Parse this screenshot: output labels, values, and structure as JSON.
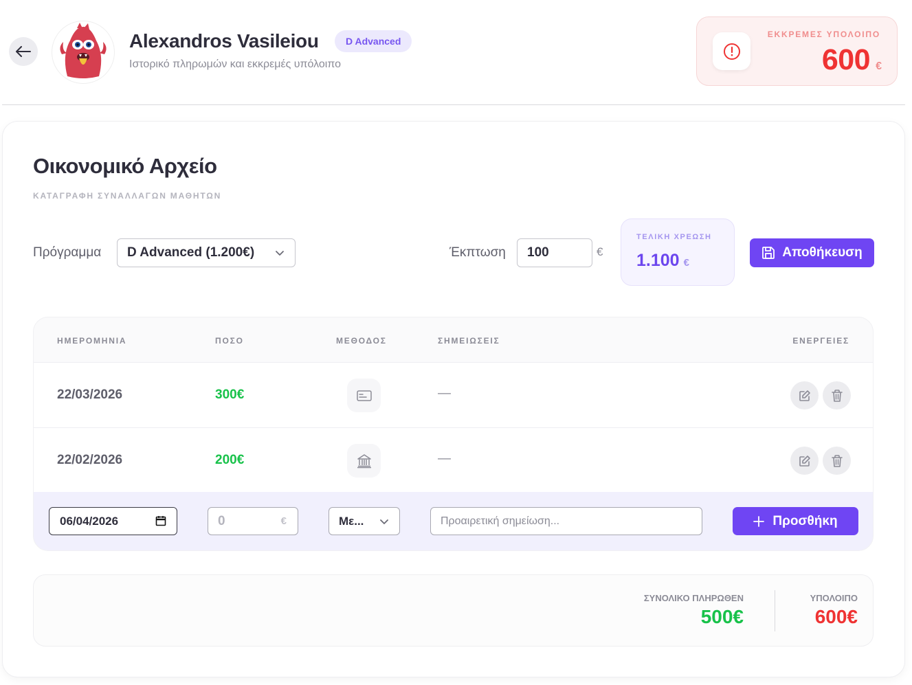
{
  "header": {
    "student_name": "Alexandros Vasileiou",
    "program_badge": "D Advanced",
    "subtitle": "Ιστορικό πληρωμών και εκκρεμές υπόλοιπο",
    "pending": {
      "label": "ΕΚΚΡΕΜΕΣ ΥΠΟΛΟΙΠΟ",
      "amount": "600",
      "currency": "€"
    }
  },
  "main": {
    "title": "Οικονομικό Αρχείο",
    "subtitle": "ΚΑΤΑΓΡΑΦΗ ΣΥΝΑΛΛΑΓΩΝ ΜΑΘΗΤΩΝ",
    "program_label": "Πρόγραμμα",
    "program_selected": "D Advanced (1.200€)",
    "discount_label": "Έκπτωση",
    "discount_value": "100",
    "discount_currency": "€",
    "final_charge": {
      "label": "ΤΕΛΙΚΗ ΧΡΕΩΣΗ",
      "amount": "1.100",
      "currency": "€"
    },
    "save_label": "Αποθήκευση"
  },
  "table": {
    "headers": {
      "date": "ΗΜΕΡΟΜΗΝΙΑ",
      "amount": "ΠΟΣΟ",
      "method": "ΜΕΘΟΔΟΣ",
      "notes": "ΣΗΜΕΙΩΣΕΙΣ",
      "actions": "ΕΝΕΡΓΕΙΕΣ"
    },
    "rows": [
      {
        "date": "22/03/2026",
        "amount": "300€",
        "method_icon": "card-icon",
        "notes": "—"
      },
      {
        "date": "22/02/2026",
        "amount": "200€",
        "method_icon": "bank-icon",
        "notes": "—"
      }
    ],
    "new_entry": {
      "date_value": "06/04/2026",
      "amount_placeholder": "0",
      "amount_currency": "€",
      "method_selected": "Με...",
      "note_placeholder": "Προαιρετική σημείωση...",
      "add_label": "Προσθήκη"
    }
  },
  "summary": {
    "total_paid_label": "ΣΥΝΟΛΙΚΟ ΠΛΗΡΩΘΕΝ",
    "total_paid_value": "500€",
    "balance_label": "ΥΠΟΛΟΙΠΟ",
    "balance_value": "600€"
  },
  "colors": {
    "accent": "#6f45f3",
    "paid_green": "#18c24a",
    "due_red": "#ef3333"
  }
}
